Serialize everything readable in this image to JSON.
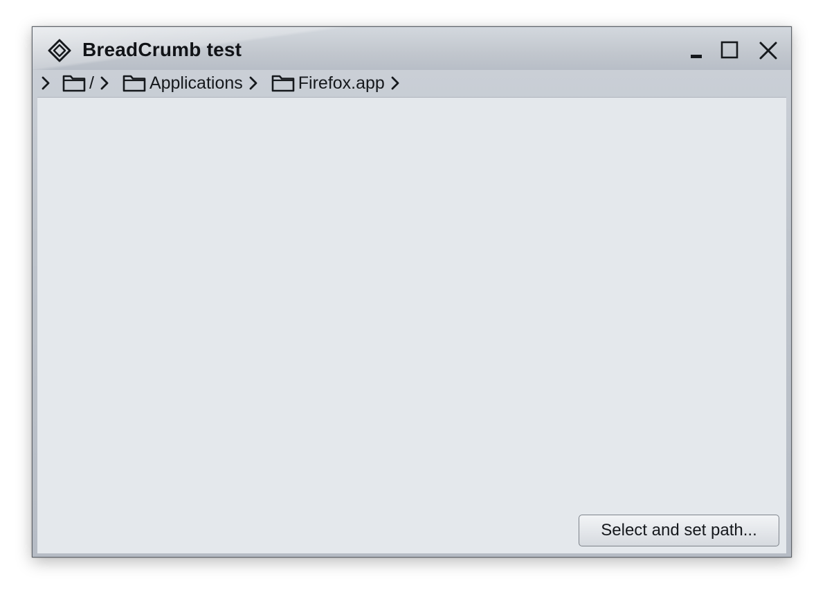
{
  "window": {
    "title": "BreadCrumb test",
    "icon": "diamond-app-icon",
    "controls": {
      "minimize": "minimize-icon",
      "maximize": "maximize-icon",
      "close": "close-icon"
    }
  },
  "breadcrumb": {
    "separator_icon": "chevron-right-icon",
    "folder_icon": "folder-icon",
    "items": [
      {
        "label": "/"
      },
      {
        "label": "Applications"
      },
      {
        "label": "Firefox.app"
      }
    ]
  },
  "actions": {
    "select_path_label": "Select and set path..."
  },
  "colors": {
    "titlebar": "#c2c7ce",
    "content_background": "#e4e8ec",
    "text": "#15181c"
  }
}
